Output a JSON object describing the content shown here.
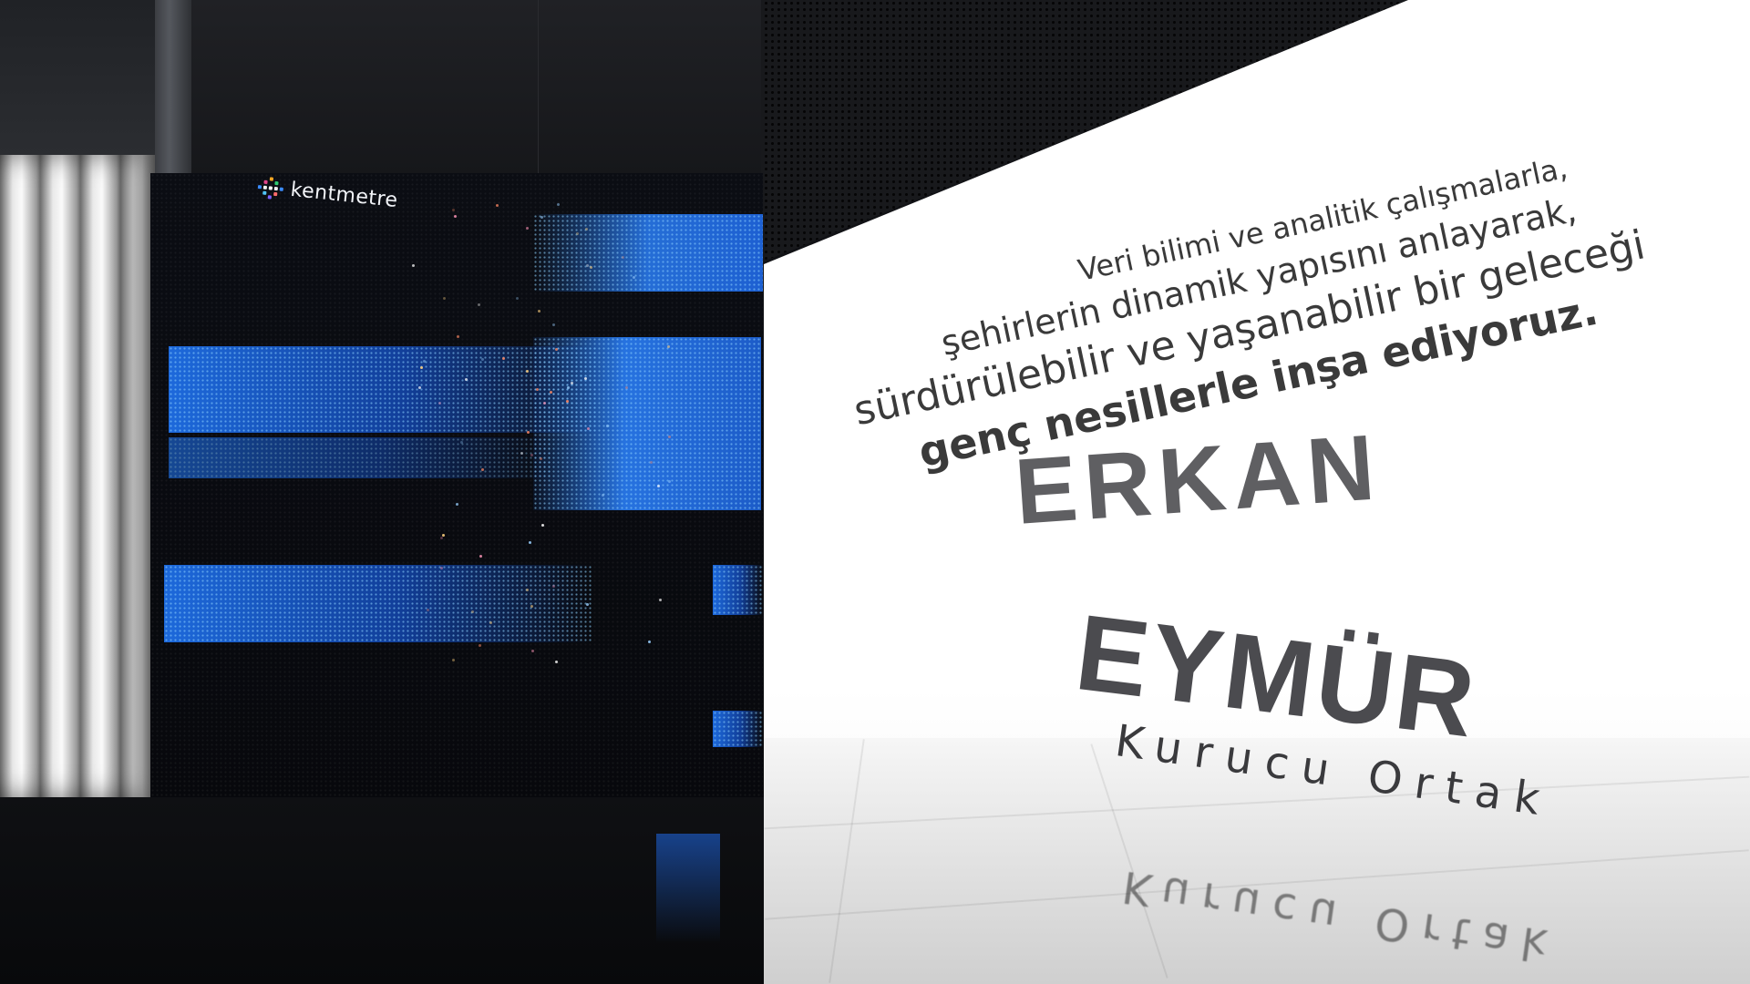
{
  "brand": {
    "name": "kentmetre"
  },
  "quote": {
    "line1": "Veri bilimi ve analitik çalışmalarla,",
    "line2": "şehirlerin dinamik yapısını anlayarak,",
    "line3": "sürdürülebilir ve yaşanabilir bir geleceği",
    "line4": "genç nesillerle inşa ediyoruz."
  },
  "person": {
    "first_name": "ERKAN",
    "last_name": "EYMÜR",
    "role": "Kurucu Ortak"
  },
  "colors": {
    "led_blue": "#1e6ee6",
    "wall_white": "#ffffff",
    "text_dark": "#3a3a3a",
    "name_gray": "#5f5f62"
  }
}
